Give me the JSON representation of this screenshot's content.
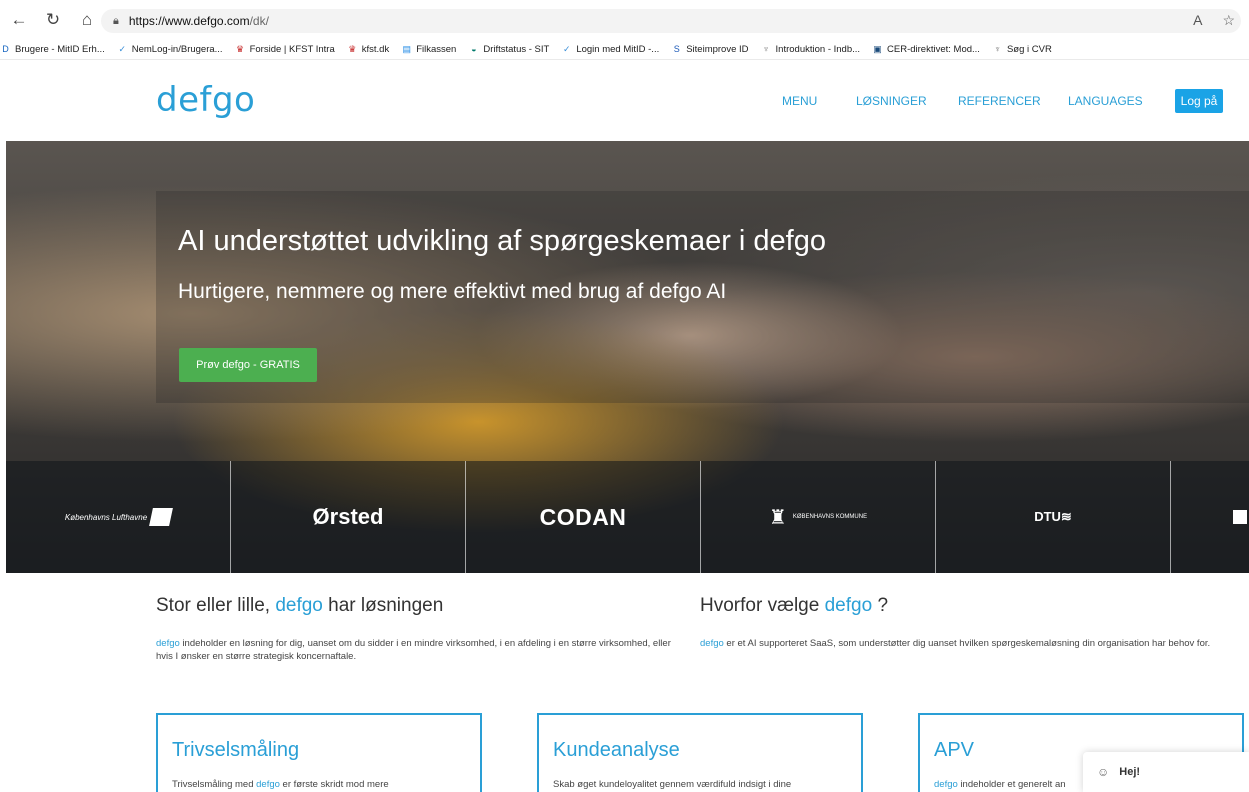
{
  "browser": {
    "back": "←",
    "reload": "↻",
    "home": "⌂",
    "url_host": "https://www.defgo.com",
    "url_path": "/dk/",
    "read_aloud": "A",
    "favorite": "☆"
  },
  "bookmarks": [
    {
      "label": "Brugere - MitID Erh...",
      "icon": "D",
      "color": "#1565c0"
    },
    {
      "label": "NemLog-in/Brugera...",
      "icon": "✓",
      "color": "#3a8fd8"
    },
    {
      "label": "Forside | KFST Intra",
      "icon": "♛",
      "color": "#c62828"
    },
    {
      "label": "kfst.dk",
      "icon": "♛",
      "color": "#c62828"
    },
    {
      "label": "Filkassen",
      "icon": "▤",
      "color": "#1e88e5"
    },
    {
      "label": "Driftstatus - SIT",
      "icon": "◒",
      "color": "#00796b"
    },
    {
      "label": "Login med MitID -...",
      "icon": "✓",
      "color": "#3a8fd8"
    },
    {
      "label": "Siteimprove ID",
      "icon": "S",
      "color": "#1e5bb8"
    },
    {
      "label": "Introduktion - Indb...",
      "icon": "♆",
      "color": "#777"
    },
    {
      "label": "CER-direktivet: Mod...",
      "icon": "▣",
      "color": "#1a4a7a"
    },
    {
      "label": "Søg i CVR",
      "icon": "♆",
      "color": "#777"
    }
  ],
  "site": {
    "logo": "defgo",
    "nav": [
      "MENU",
      "LØSNINGER",
      "REFERENCER",
      "LANGUAGES"
    ],
    "login": "Log på"
  },
  "hero": {
    "title": "AI understøttet udvikling af spørgeskemaer i defgo",
    "subtitle": "Hurtigere, nemmere og mere effektivt med brug af defgo AI",
    "cta": "Prøv defgo - GRATIS",
    "logos": [
      "Københavns Lufthavne",
      "Ørsted",
      "CODAN",
      "KØBENHAVNS KOMMUNE",
      "DTU"
    ]
  },
  "sections": {
    "left_title_pre": "Stor eller lille,",
    "left_title_brand": "defgo",
    "left_title_post": "har løsningen",
    "left_brand": "defgo",
    "left_text": "indeholder en løsning for dig, uanset om du sidder i en mindre virksomhed, i en afdeling i en større virksomhed, eller hvis I ønsker en større strategisk koncernaftale.",
    "right_title_pre": "Hvorfor vælge",
    "right_title_brand": "defgo",
    "right_title_post": "?",
    "right_brand": "defgo",
    "right_text": "er et AI supporteret SaaS, som understøtter dig uanset hvilken spørgeskemaløsning din organisation har behov for."
  },
  "cards": [
    {
      "title": "Trivselsmåling",
      "text_pre": "Trivselsmåling med",
      "brand": "defgo",
      "text_post": "er første skridt mod mere"
    },
    {
      "title": "Kundeanalyse",
      "text_pre": "Skab øget kundeloyalitet gennem værdifuld indsigt i dine",
      "brand": "",
      "text_post": ""
    },
    {
      "title": "APV",
      "text_pre": "",
      "brand": "defgo",
      "text_post": "indeholder et generelt an"
    }
  ],
  "chat": {
    "label": "Hej!"
  }
}
